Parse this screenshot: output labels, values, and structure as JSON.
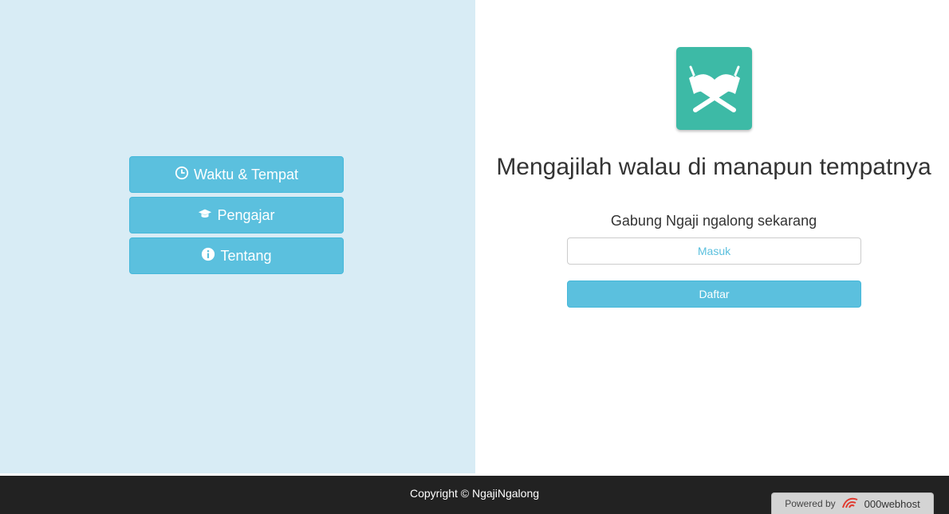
{
  "nav": {
    "waktu_label": "Waktu & Tempat",
    "pengajar_label": "Pengajar",
    "tentang_label": "Tentang"
  },
  "hero": {
    "headline": "Mengajilah walau di manapun tempatnya",
    "subline": "Gabung Ngaji ngalong sekarang",
    "masuk_label": "Masuk",
    "daftar_label": "Daftar"
  },
  "footer": {
    "copyright": "Copyright © NgajiNgalong",
    "powered_by": "Powered by",
    "host_brand": "000webhost"
  },
  "colors": {
    "left_bg": "#d8ecf5",
    "button_info": "#5bc0de",
    "logo_teal": "#3dbaa6",
    "footer_bg": "#222222"
  },
  "icons": {
    "waktu": "clock-icon",
    "pengajar": "graduation-cap-icon",
    "tentang": "info-circle-icon",
    "logo": "quran-stand-icon",
    "host": "webhost-logo-icon"
  }
}
